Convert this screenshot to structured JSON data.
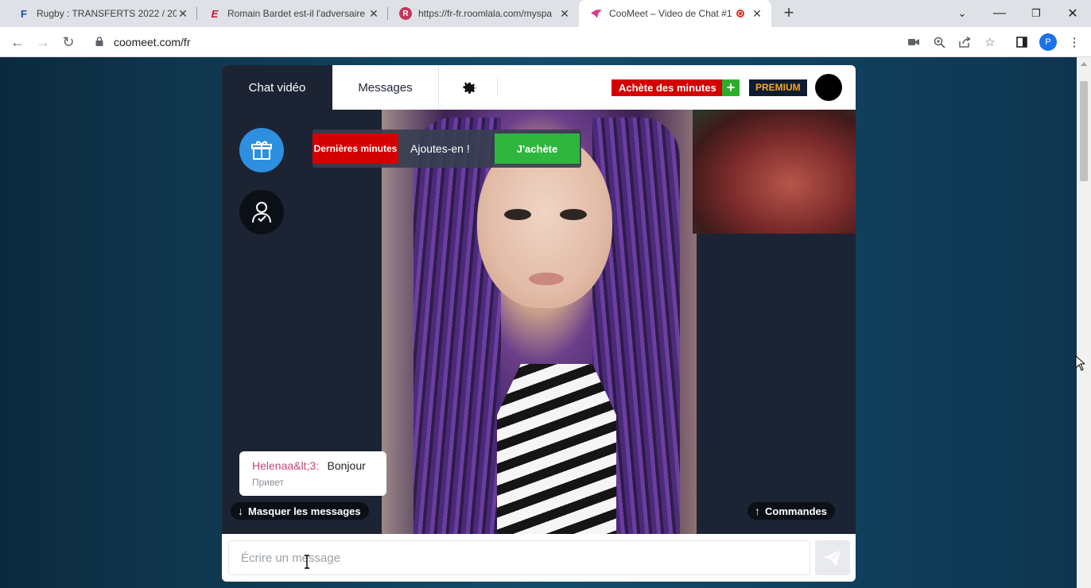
{
  "browser": {
    "tabs": [
      {
        "title": "Rugby : TRANSFERTS 2022 / 2023",
        "favicon": "F"
      },
      {
        "title": "Romain Bardet est-il l'adversaire",
        "favicon": "E"
      },
      {
        "title": "https://fr-fr.roomlala.com/myspa",
        "favicon": "R"
      },
      {
        "title": "CooMeet – Video de Chat #1",
        "favicon": "coomeet-logo"
      }
    ],
    "url": "coomeet.com/fr",
    "new_tab": "+",
    "profile_initial": "P"
  },
  "app": {
    "tabs": {
      "chat": "Chat vidéo",
      "messages": "Messages"
    },
    "buy_minutes": "Achète des minutes",
    "plus": "+",
    "premium": "PREMIUM",
    "minutes_bar": {
      "label": "Dernières minutes",
      "text": "Ajoutes-en !",
      "button": "J'achète"
    },
    "chat_message": {
      "sender": "Helenaa&lt;3:",
      "text": "Bonjour",
      "translation": "Привет"
    },
    "hide_messages": "Masquer les messages",
    "commands": "Commandes",
    "composer_placeholder": "Écrire un message"
  },
  "colors": {
    "brand_red": "#d40000",
    "brand_green": "#30b53e",
    "premium_gold": "#f5a623",
    "panel": "#1c2433",
    "gift_blue": "#2d8fe0"
  }
}
